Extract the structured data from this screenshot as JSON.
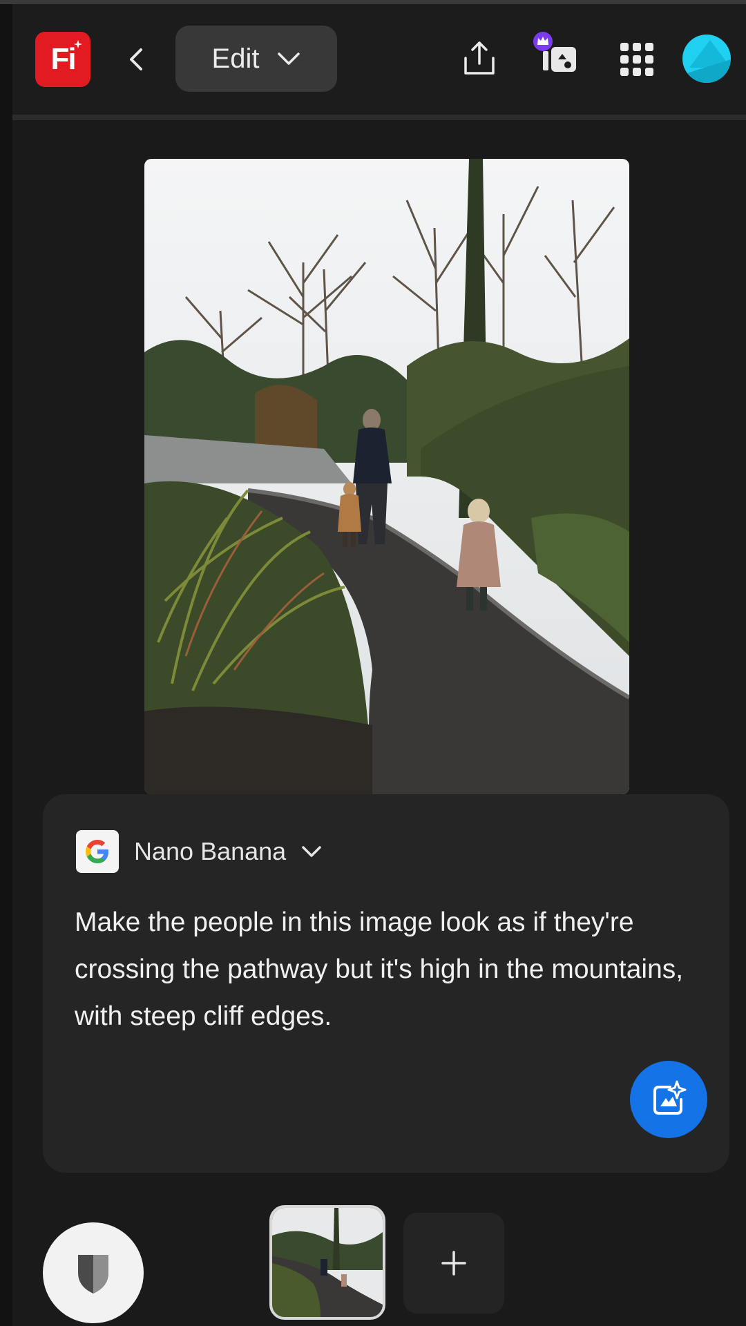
{
  "header": {
    "app_logo_text": "Fi",
    "mode_label": "Edit",
    "icons": [
      "back-icon",
      "chevron-down-icon",
      "share-icon",
      "generate-variations-icon",
      "premium-crown-icon",
      "app-grid-icon",
      "avatar"
    ]
  },
  "canvas": {
    "image_description_icon": "photo"
  },
  "prompt": {
    "model_name": "Nano Banana",
    "model_provider_icon": "google-g-icon",
    "text": "Make the people in this image look as if they're crossing the pathway but it's high in the mountains, with steep cliff edges.",
    "submit_icon": "generate-sparkle-icon"
  },
  "bottom_bar": {
    "add_label": "+",
    "icons": [
      "shield-icon",
      "thumbnail",
      "add-icon"
    ]
  },
  "colors": {
    "background": "#1a1a1a",
    "card": "#252525",
    "accent_blue": "#1473e6",
    "logo_red": "#e21b23",
    "avatar_cyan": "#1fd0f0"
  }
}
